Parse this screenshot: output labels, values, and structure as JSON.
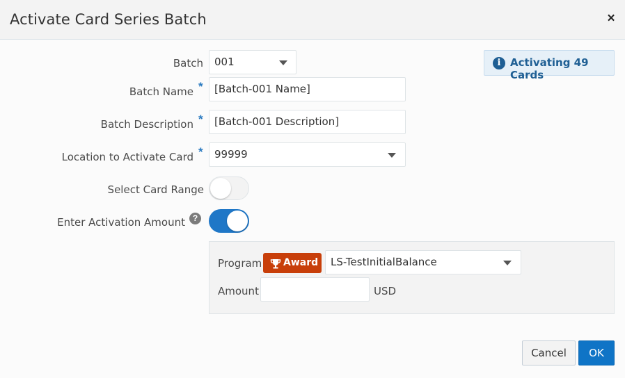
{
  "dialog": {
    "title": "Activate Card Series Batch",
    "close_glyph": "×"
  },
  "info_banner": {
    "icon": "info-icon",
    "icon_glyph": "i",
    "text": "Activating 49 Cards"
  },
  "form": {
    "batch": {
      "label": "Batch",
      "value": "001"
    },
    "batch_name": {
      "label": "Batch Name",
      "required": "*",
      "value": "[Batch-001 Name]"
    },
    "batch_description": {
      "label": "Batch Description",
      "required": "*",
      "value": "[Batch-001 Description]"
    },
    "location": {
      "label": "Location to Activate Card",
      "required": "*",
      "value": "99999"
    },
    "select_card_range": {
      "label": "Select Card Range",
      "on": false
    },
    "enter_activation_amount": {
      "label": "Enter Activation Amount",
      "on": true,
      "help_glyph": "?"
    }
  },
  "program_panel": {
    "program_label": "Program",
    "award_badge": "Award",
    "program_value": "LS-TestInitialBalance",
    "amount_label": "Amount",
    "amount_value": "",
    "currency": "USD"
  },
  "footer": {
    "cancel_label": "Cancel",
    "ok_label": "OK"
  },
  "colors": {
    "accent": "#0f74c6",
    "award": "#c83f0a",
    "info_text": "#1f5f94",
    "required_star": "#2a7ac0"
  }
}
